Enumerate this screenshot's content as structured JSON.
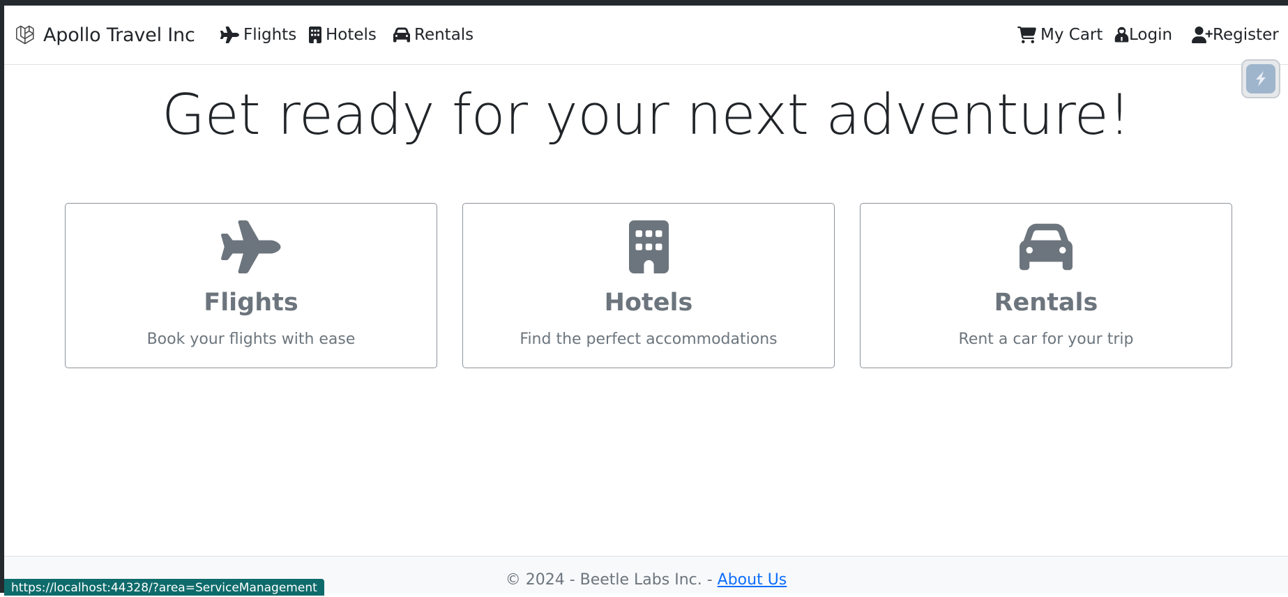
{
  "navbar": {
    "brand": "Apollo Travel Inc",
    "links": [
      {
        "label": "Flights",
        "icon": "plane-icon"
      },
      {
        "label": "Hotels",
        "icon": "building-icon"
      },
      {
        "label": "Rentals",
        "icon": "car-icon"
      }
    ],
    "right": [
      {
        "label": "My Cart",
        "icon": "cart-icon"
      },
      {
        "label": "Login",
        "icon": "user-secret-icon"
      },
      {
        "label": "Register",
        "icon": "user-plus-icon"
      }
    ]
  },
  "hero": {
    "title": "Get ready for your next adventure!"
  },
  "cards": [
    {
      "title": "Flights",
      "desc": "Book your flights with ease",
      "icon": "plane-icon"
    },
    {
      "title": "Hotels",
      "desc": "Find the perfect accommodations",
      "icon": "building-icon"
    },
    {
      "title": "Rentals",
      "desc": "Rent a car for your trip",
      "icon": "car-icon"
    }
  ],
  "footer": {
    "text": "© 2024 - Beetle Labs Inc. - ",
    "link": " About Us"
  },
  "status": {
    "url": "https://localhost:44328/?area=ServiceManagement"
  },
  "colors": {
    "muted": "#6c757d",
    "link": "#0d6efd",
    "status_bg": "#0f6b6b"
  }
}
